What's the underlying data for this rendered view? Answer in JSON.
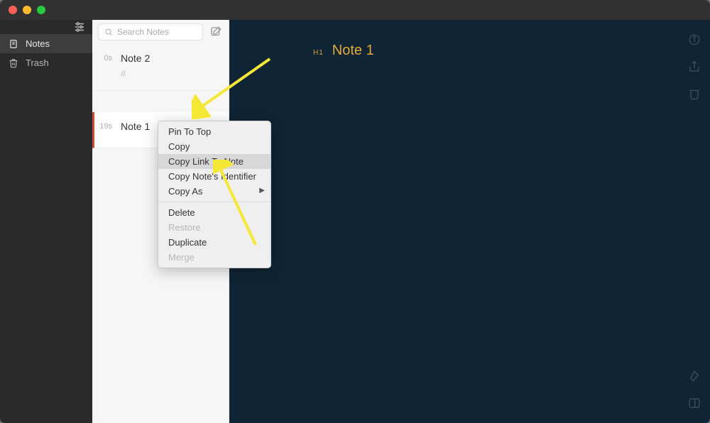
{
  "sidebar": {
    "items": [
      {
        "label": "Notes"
      },
      {
        "label": "Trash"
      }
    ]
  },
  "search": {
    "placeholder": "Search Notes"
  },
  "notes": [
    {
      "time": "0s",
      "title": "Note 2",
      "sub": "#"
    },
    {
      "time": "19s",
      "title": "Note 1",
      "sub": ""
    }
  ],
  "editor": {
    "tag": "H1",
    "title": "Note 1"
  },
  "context_menu": {
    "items": [
      {
        "label": "Pin To Top"
      },
      {
        "label": "Copy"
      },
      {
        "label": "Copy Link To Note"
      },
      {
        "label": "Copy Note's Identifier"
      },
      {
        "label": "Copy As"
      },
      {
        "label": "Delete"
      },
      {
        "label": "Restore"
      },
      {
        "label": "Duplicate"
      },
      {
        "label": "Merge"
      }
    ]
  }
}
